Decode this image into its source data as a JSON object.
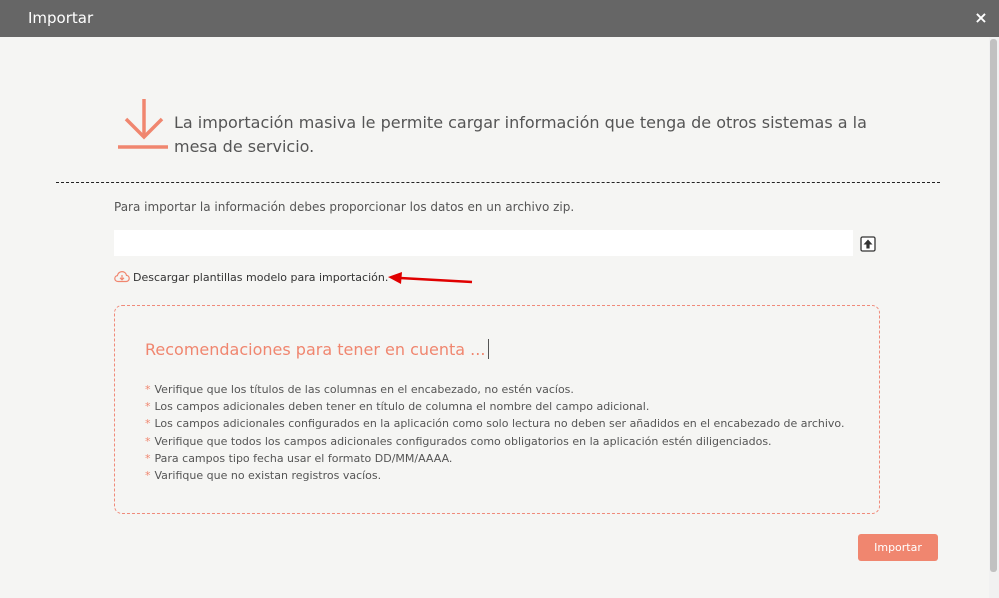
{
  "dialog": {
    "title": "Importar",
    "close_label": "×"
  },
  "hero": {
    "icon": "download-arrow-icon",
    "text": "La importación masiva le permite cargar información que tenga de otros sistemas a la mesa de servicio."
  },
  "upload": {
    "instruction": "Para importar la información debes proporcionar los datos en un archivo zip.",
    "file_value": "",
    "upload_icon": "upload-arrow-icon"
  },
  "download_templates": {
    "icon": "cloud-download-icon",
    "label": "Descargar plantillas modelo para importación."
  },
  "recommendations": {
    "title": "Recomendaciones para tener en cuenta ...",
    "bullet": "*",
    "items": [
      "Verifique que los títulos de las columnas en el encabezado, no estén vacíos.",
      "Los campos adicionales deben tener en título de columna el nombre del campo adicional.",
      "Los campos adicionales configurados en la aplicación como solo lectura no deben ser añadidos en el encabezado de archivo.",
      "Verifique que todos los campos adicionales configurados como obligatorios en la aplicación estén diligenciados.",
      "Para campos tipo fecha usar el formato DD/MM/AAAA.",
      "Varifique que no existan registros vacíos."
    ]
  },
  "actions": {
    "import_label": "Importar"
  },
  "colors": {
    "accent": "#f0866f",
    "titlebar": "#666666",
    "background": "#f5f5f3",
    "annotation_arrow": "#e00000"
  }
}
